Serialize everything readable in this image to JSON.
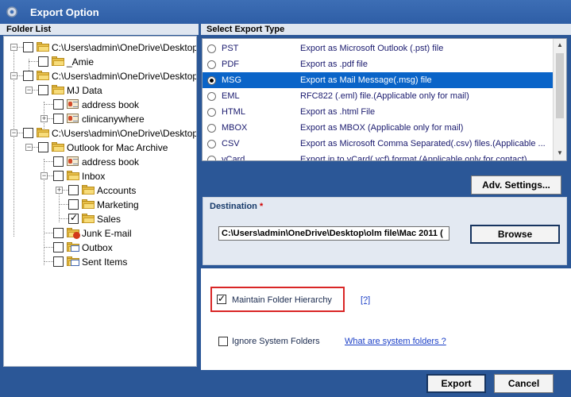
{
  "window": {
    "title": "Export Option",
    "icon": "settings-gear-icon"
  },
  "folder_list": {
    "header": "Folder List",
    "nodes": [
      {
        "label": "C:\\Users\\admin\\OneDrive\\Desktop",
        "icon": "folder-icon",
        "checked": false
      },
      {
        "label": "_Amie",
        "icon": "folder-icon",
        "checked": false
      },
      {
        "label": "C:\\Users\\admin\\OneDrive\\Desktop",
        "icon": "folder-icon",
        "checked": false
      },
      {
        "label": "MJ Data",
        "icon": "folder-icon",
        "checked": false
      },
      {
        "label": "address book",
        "icon": "contacts-icon",
        "checked": false
      },
      {
        "label": "clinicanywhere",
        "icon": "contacts-icon",
        "checked": false
      },
      {
        "label": "C:\\Users\\admin\\OneDrive\\Desktop",
        "icon": "folder-icon",
        "checked": false
      },
      {
        "label": "Outlook for Mac Archive",
        "icon": "folder-icon",
        "checked": false
      },
      {
        "label": "address book",
        "icon": "contacts-icon",
        "checked": false
      },
      {
        "label": "Inbox",
        "icon": "folder-icon",
        "checked": false
      },
      {
        "label": "Accounts",
        "icon": "folder-icon",
        "checked": false
      },
      {
        "label": "Marketing",
        "icon": "folder-icon",
        "checked": false
      },
      {
        "label": "Sales",
        "icon": "folder-icon",
        "checked": true
      },
      {
        "label": "Junk E-mail",
        "icon": "junk-folder-icon",
        "checked": false
      },
      {
        "label": "Outbox",
        "icon": "outbox-folder-icon",
        "checked": false
      },
      {
        "label": "Sent Items",
        "icon": "sent-folder-icon",
        "checked": false
      }
    ]
  },
  "export_type": {
    "header": "Select Export Type",
    "options": [
      {
        "name": "PST",
        "desc": "Export as Microsoft Outlook (.pst) file",
        "selected": false
      },
      {
        "name": "PDF",
        "desc": "Export as .pdf file",
        "selected": false
      },
      {
        "name": "MSG",
        "desc": "Export as Mail Message(.msg) file",
        "selected": true
      },
      {
        "name": "EML",
        "desc": "RFC822 (.eml) file.(Applicable only for mail)",
        "selected": false
      },
      {
        "name": "HTML",
        "desc": "Export as .html File",
        "selected": false
      },
      {
        "name": "MBOX",
        "desc": "Export as MBOX (Applicable only for mail)",
        "selected": false
      },
      {
        "name": "CSV",
        "desc": "Export as Microsoft Comma Separated(.csv) files.(Applicable ...",
        "selected": false
      },
      {
        "name": "vCard",
        "desc": "Export in to vCard(.vcf) format.(Applicable only for contact)",
        "selected": false
      }
    ]
  },
  "adv_settings_label": "Adv. Settings...",
  "destination": {
    "label": "Destination",
    "required_mark": "*",
    "path": "C:\\Users\\admin\\OneDrive\\Desktop\\olm file\\Mac 2011 (",
    "browse_label": "Browse"
  },
  "options": {
    "maintain_hierarchy": {
      "label": "Maintain Folder Hierarchy",
      "checked": true
    },
    "help_link": "[?]",
    "ignore_system": {
      "label": "Ignore System Folders",
      "checked": false
    },
    "system_folders_link": "What are system folders ?"
  },
  "actions": {
    "export_label": "Export",
    "cancel_label": "Cancel"
  }
}
